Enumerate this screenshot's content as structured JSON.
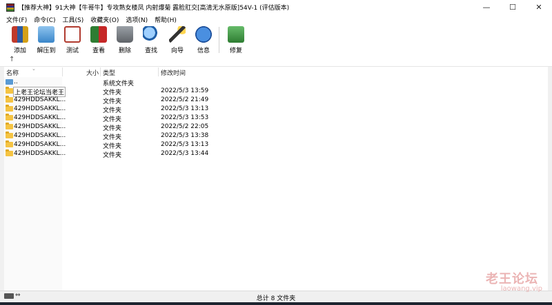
{
  "window": {
    "title": "【推荐大神】91大神【牛哥牛】专攻熟女楼凤 内射爆菊 露脸肛交[高清无水原版]54V-1 (评估版本)",
    "controls": {
      "minimize": "—",
      "maximize": "☐",
      "close": "✕"
    }
  },
  "menu": [
    {
      "label": "文件(F)"
    },
    {
      "label": "命令(C)"
    },
    {
      "label": "工具(S)"
    },
    {
      "label": "收藏夹(O)"
    },
    {
      "label": "选项(N)"
    },
    {
      "label": "帮助(H)"
    }
  ],
  "toolbar": [
    {
      "label": "添加",
      "icon": "add-books-icon"
    },
    {
      "label": "解压到",
      "icon": "extract-folder-icon"
    },
    {
      "label": "测试",
      "icon": "test-check-icon"
    },
    {
      "label": "查看",
      "icon": "view-book-icon"
    },
    {
      "label": "删除",
      "icon": "trash-icon"
    },
    {
      "label": "查找",
      "icon": "find-magnifier-icon"
    },
    {
      "label": "向导",
      "icon": "wizard-wand-icon"
    },
    {
      "label": "信息",
      "icon": "info-icon"
    },
    {
      "label": "修复",
      "icon": "repair-book-icon"
    }
  ],
  "pathbar": {
    "up_icon": "↑"
  },
  "columns": {
    "name": "名称",
    "size": "大小",
    "type": "类型",
    "mtime": "修改时间"
  },
  "files": [
    {
      "name": "..",
      "size": "",
      "type": "系统文件夹",
      "mtime": "",
      "icon": "up-folder-icon"
    },
    {
      "name": "上老王论坛当老王",
      "size": "",
      "type": "文件夹",
      "mtime": "2022/5/3 13:59",
      "icon": "folder-icon"
    },
    {
      "name": "429HDDSAKKL...",
      "size": "",
      "type": "文件夹",
      "mtime": "2022/5/2 21:49",
      "icon": "folder-icon"
    },
    {
      "name": "429HDDSAKKL...",
      "size": "",
      "type": "文件夹",
      "mtime": "2022/5/3 13:13",
      "icon": "folder-icon"
    },
    {
      "name": "429HDDSAKKL...",
      "size": "",
      "type": "文件夹",
      "mtime": "2022/5/3 13:53",
      "icon": "folder-icon"
    },
    {
      "name": "429HDDSAKKL...",
      "size": "",
      "type": "文件夹",
      "mtime": "2022/5/2 22:05",
      "icon": "folder-icon"
    },
    {
      "name": "429HDDSAKKL...",
      "size": "",
      "type": "文件夹",
      "mtime": "2022/5/3 13:38",
      "icon": "folder-icon"
    },
    {
      "name": "429HDDSAKKL...",
      "size": "",
      "type": "文件夹",
      "mtime": "2022/5/3 13:13",
      "icon": "folder-icon"
    },
    {
      "name": "429HDDSAKKL...",
      "size": "",
      "type": "文件夹",
      "mtime": "2022/5/3 13:44",
      "icon": "folder-icon"
    }
  ],
  "status": {
    "text": "总计 8 文件夹",
    "drive_arrows": "⇔"
  },
  "watermark": {
    "line1": "老王论坛",
    "line2": "laowang.vip"
  }
}
